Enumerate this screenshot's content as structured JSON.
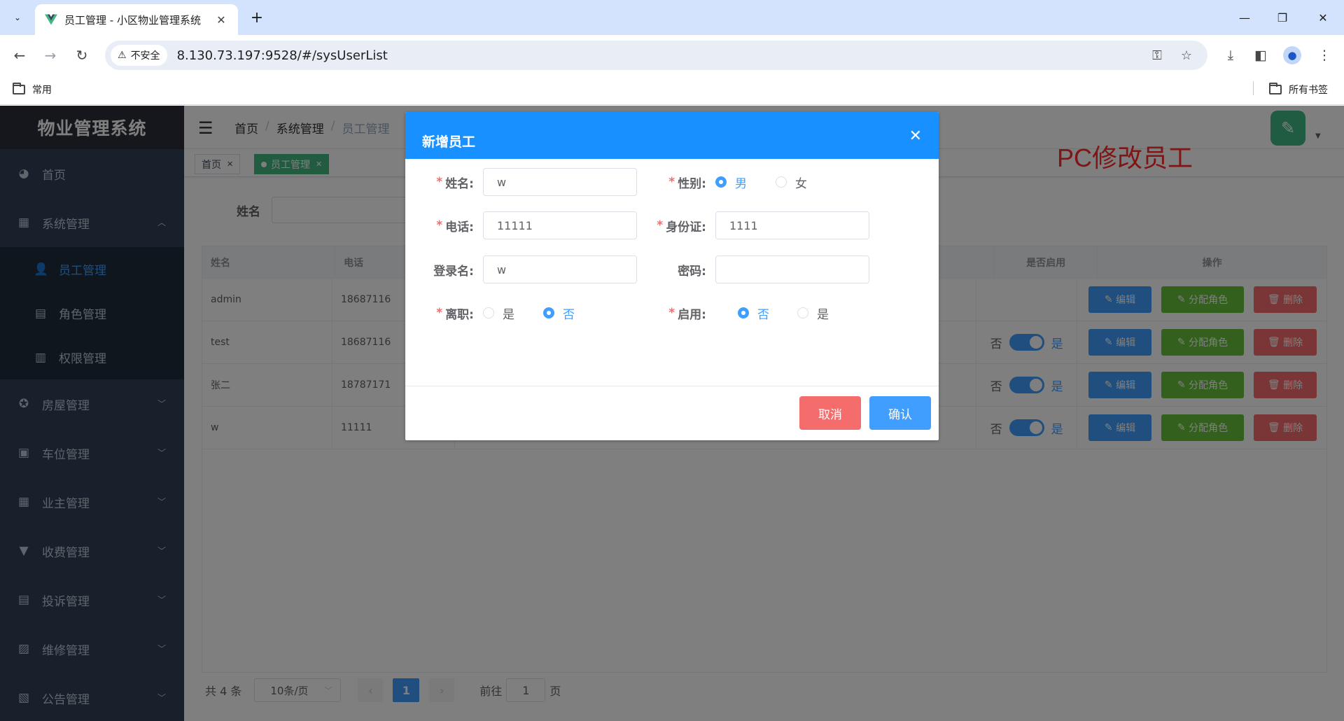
{
  "browser": {
    "tab_title": "员工管理 - 小区物业管理系统",
    "security_label": "不安全",
    "url": "8.130.73.197:9528/#/sysUserList",
    "bookmark_left": "常用",
    "bookmark_right": "所有书签"
  },
  "sidebar": {
    "logo": "物业管理系统",
    "items": [
      {
        "label": "首页",
        "icon": "dashboard-icon"
      },
      {
        "label": "系统管理",
        "icon": "grid-icon"
      },
      {
        "label": "员工管理",
        "icon": "user-icon"
      },
      {
        "label": "角色管理",
        "icon": "calendar-icon"
      },
      {
        "label": "权限管理",
        "icon": "building-icon"
      },
      {
        "label": "房屋管理",
        "icon": "house-icon"
      },
      {
        "label": "车位管理",
        "icon": "parking-icon"
      },
      {
        "label": "业主管理",
        "icon": "grid-icon"
      },
      {
        "label": "收费管理",
        "icon": "money-icon"
      },
      {
        "label": "投诉管理",
        "icon": "calendar-icon"
      },
      {
        "label": "维修管理",
        "icon": "image-icon"
      },
      {
        "label": "公告管理",
        "icon": "notice-icon"
      }
    ]
  },
  "navbar": {
    "breadcrumb": [
      "首页",
      "系统管理",
      "员工管理"
    ],
    "watermark": "PC修改员工"
  },
  "tags": {
    "home": "首页",
    "current": "员工管理"
  },
  "search": {
    "label": "姓名"
  },
  "table": {
    "headers": [
      "姓名",
      "电话",
      "是否启用",
      "操作"
    ],
    "rows": [
      {
        "name": "admin",
        "phone": "18687116"
      },
      {
        "name": "test",
        "phone": "18687116",
        "off": "否",
        "on": "是"
      },
      {
        "name": "张二",
        "phone": "18787171",
        "off": "否",
        "on": "是"
      },
      {
        "name": "w",
        "phone": "11111",
        "off": "否",
        "on": "是"
      }
    ],
    "btn_edit": "编辑",
    "btn_role": "分配角色",
    "btn_delete": "删除"
  },
  "pager": {
    "total": "共 4 条",
    "page_size": "10条/页",
    "current_page": "1",
    "goto_prefix": "前往",
    "goto_value": "1",
    "goto_suffix": "页"
  },
  "dialog": {
    "title": "新增员工",
    "name_label": "姓名:",
    "name_value": "w",
    "gender_label": "性别:",
    "gender_male": "男",
    "gender_female": "女",
    "phone_label": "电话:",
    "phone_value": "11111",
    "idcard_label": "身份证:",
    "idcard_value": "1111",
    "login_label": "登录名:",
    "login_value": "w",
    "password_label": "密码:",
    "password_value": "",
    "resign_label": "离职:",
    "resign_yes": "是",
    "resign_no": "否",
    "enable_label": "启用:",
    "enable_no": "否",
    "enable_yes": "是",
    "cancel": "取消",
    "confirm": "确认"
  },
  "colors": {
    "sidebar_bg": "#304156",
    "primary": "#409eff",
    "dialog_header": "#1890ff",
    "success": "#67c23a",
    "danger": "#f56c6c",
    "tag_active": "#42b983"
  }
}
